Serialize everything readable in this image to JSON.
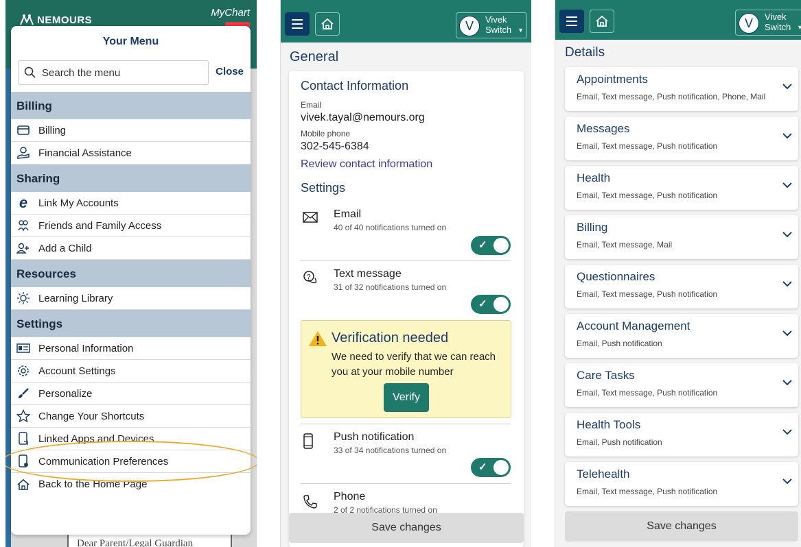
{
  "menu_screen": {
    "brand_logo": "NEMOURS",
    "mychart_logo": "MyChart",
    "menu_title": "Your Menu",
    "search_placeholder": "Search the menu",
    "close_label": "Close",
    "sections": [
      {
        "title": "Billing",
        "items": [
          {
            "label": "Billing",
            "icon": "credit-card-icon"
          },
          {
            "label": "Financial Assistance",
            "icon": "financial-hand-icon"
          }
        ]
      },
      {
        "title": "Sharing",
        "items": [
          {
            "label": "Link My Accounts",
            "icon": "epic-link-icon"
          },
          {
            "label": "Friends and Family Access",
            "icon": "people-icon"
          },
          {
            "label": "Add a Child",
            "icon": "add-person-icon"
          }
        ]
      },
      {
        "title": "Resources",
        "items": [
          {
            "label": "Learning Library",
            "icon": "lightbulb-icon"
          }
        ]
      },
      {
        "title": "Settings",
        "items": [
          {
            "label": "Personal Information",
            "icon": "id-card-icon"
          },
          {
            "label": "Account Settings",
            "icon": "gear-icon"
          },
          {
            "label": "Personalize",
            "icon": "paintbrush-icon"
          },
          {
            "label": "Change Your Shortcuts",
            "icon": "star-icon"
          },
          {
            "label": "Linked Apps and Devices",
            "icon": "phone-link-icon"
          },
          {
            "label": "Communication Preferences",
            "icon": "phone-settings-icon"
          },
          {
            "label": "Back to the Home Page",
            "icon": "home-icon"
          }
        ]
      }
    ],
    "background_letter": "Dear Parent/Legal Guardian",
    "highlight_color": "#f0a92b"
  },
  "header": {
    "user_initial": "V",
    "user_name": "Vivek",
    "switch_label": "Switch"
  },
  "general_screen": {
    "section_title": "General",
    "contact_title": "Contact Information",
    "email_label": "Email",
    "email_value": "vivek.tayal@nemours.org",
    "phone_label": "Mobile phone",
    "phone_value": "302-545-6384",
    "review_link": "Review contact information",
    "settings_title": "Settings",
    "settings": [
      {
        "name": "Email",
        "status": "40 of 40 notifications turned on",
        "enabled": true,
        "icon": "envelope-icon"
      },
      {
        "name": "Text message",
        "status": "31 of 32 notifications turned on",
        "enabled": true,
        "icon": "chat-bubble-icon"
      },
      {
        "name": "Push notification",
        "status": "33 of 34 notifications turned on",
        "enabled": true,
        "icon": "mobile-phone-icon"
      },
      {
        "name": "Phone",
        "status": "2 of 2 notifications turned on",
        "enabled": true,
        "icon": "phone-handset-icon"
      }
    ],
    "warning": {
      "title": "Verification needed",
      "text": "We need to verify that we can reach you at your mobile number",
      "button": "Verify"
    },
    "save_label": "Save changes"
  },
  "details_screen": {
    "section_title": "Details",
    "categories": [
      {
        "title": "Appointments",
        "channels": "Email, Text message, Push notification, Phone, Mail"
      },
      {
        "title": "Messages",
        "channels": "Email, Text message, Push notification"
      },
      {
        "title": "Health",
        "channels": "Email, Text message, Push notification"
      },
      {
        "title": "Billing",
        "channels": "Email, Text message, Mail"
      },
      {
        "title": "Questionnaires",
        "channels": "Email, Text message, Push notification"
      },
      {
        "title": "Account Management",
        "channels": "Email, Push notification"
      },
      {
        "title": "Care Tasks",
        "channels": "Email, Text message, Push notification"
      },
      {
        "title": "Health Tools",
        "channels": "Email, Push notification"
      },
      {
        "title": "Telehealth",
        "channels": "Email, Text message, Push notification"
      }
    ],
    "save_label": "Save changes"
  },
  "colors": {
    "teal": "#1f7a6c",
    "navy": "#1b3d6e",
    "section_bg": "#b8c7d5",
    "warning_bg": "#fbf6c2"
  }
}
